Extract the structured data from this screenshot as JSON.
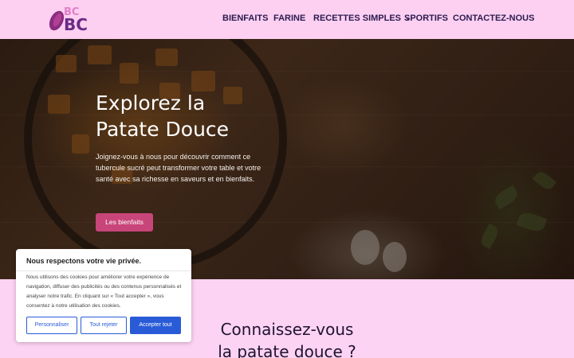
{
  "logo": {
    "line1": "BC",
    "line2": "BC"
  },
  "nav": {
    "items": [
      {
        "label": "BIENFAITS"
      },
      {
        "label": "FARINE"
      },
      {
        "label": "RECETTES SIMPLES",
        "has_dropdown": true
      },
      {
        "label": "SPORTIFS"
      },
      {
        "label": "CONTACTEZ-NOUS"
      }
    ]
  },
  "hero": {
    "title_line1": "Explorez la",
    "title_line2": "Patate Douce",
    "text": "Joignez-vous à nous pour découvrir comment ce tubercule sucré peut transformer votre table et votre santé avec sa richesse en saveurs et en bienfaits.",
    "button_label": "Les bienfaits"
  },
  "section": {
    "title_line1": "Connaissez-vous",
    "title_line2": "la patate douce ?"
  },
  "cookie": {
    "title": "Nous respectons votre vie privée.",
    "body": "Nous utilisons des cookies pour améliorer votre expérience de navigation, diffuser des publicités ou des contenus personnalisés et analyser notre trafic. En cliquant sur « Tout accepter », vous consentez à notre utilisation des cookies.",
    "customize_label": "Personnaliser",
    "reject_label": "Tout rejeter",
    "accept_label": "Accepter tout"
  },
  "colors": {
    "header_bg": "#fdd0f2",
    "nav_text": "#2b1b4f",
    "hero_button": "#c8457a",
    "cookie_accent": "#2a5bd7",
    "page_bg": "#fdd3f3"
  }
}
